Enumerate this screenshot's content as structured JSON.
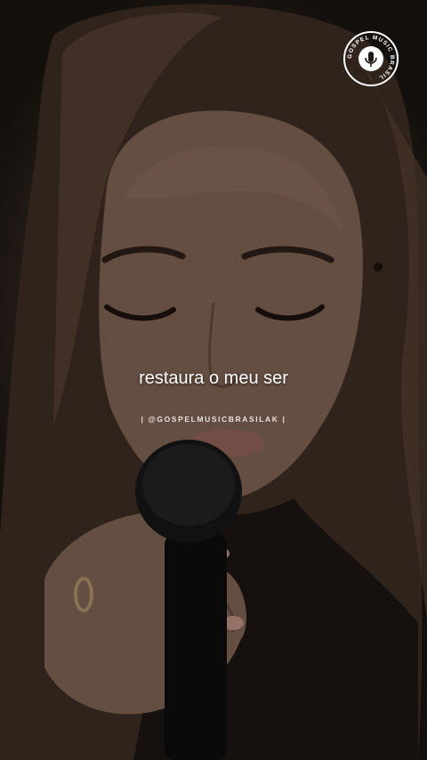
{
  "overlay": {
    "lyric": "restaura o meu ser",
    "handle": "| @GOSPELMUSICBRASILAK |"
  },
  "logo": {
    "icon": "microphone-badge-icon",
    "ring_text": "GOSPEL MUSIC BRASIL"
  },
  "colors": {
    "text": "#ffffff",
    "shadow_tint": "#1e1814",
    "skin": "#7a5e50",
    "hair": "#3a2a20"
  }
}
